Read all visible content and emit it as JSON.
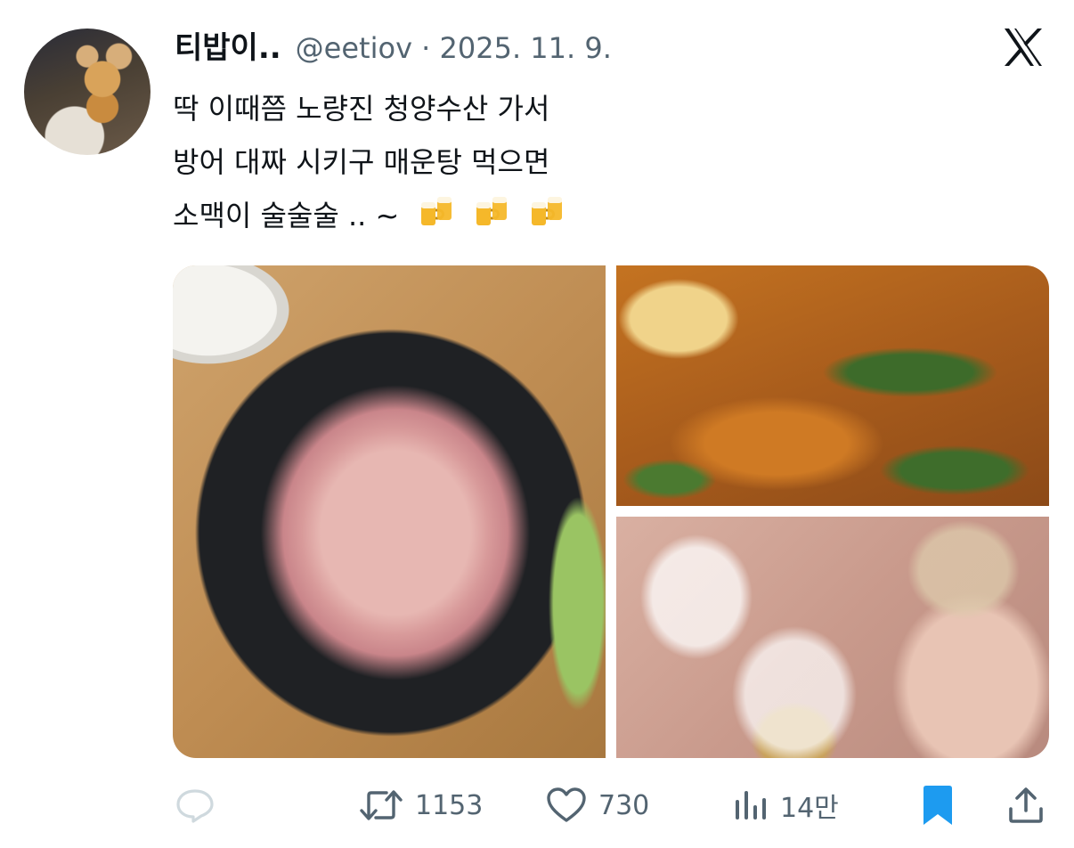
{
  "author": {
    "display_name": "티밥이..",
    "handle_line": "@eetiov · 2025. 11. 9."
  },
  "tweet": {
    "lines": [
      "딱 이때쯤 노량진 청양수산 가서",
      "방어 대짜 시키구 매운탕 먹으면",
      "소맥이 술술술 .. ~"
    ],
    "emoji": [
      "beer-mugs-icon",
      "beer-mugs-icon",
      "beer-mugs-icon"
    ]
  },
  "media": {
    "photos": [
      "yellowtail-sashimi-platter",
      "spicy-fish-stew-with-noodles",
      "glasses-toast"
    ]
  },
  "actions": {
    "reply_icon": "speech-bubble-icon",
    "retweet_count": "1153",
    "like_count": "730",
    "view_count": "14만"
  },
  "colors": {
    "text": "#0f1419",
    "secondary": "#536471",
    "bookmark_blue": "#1d9bf0",
    "reply_gray": "#cfd9de"
  }
}
